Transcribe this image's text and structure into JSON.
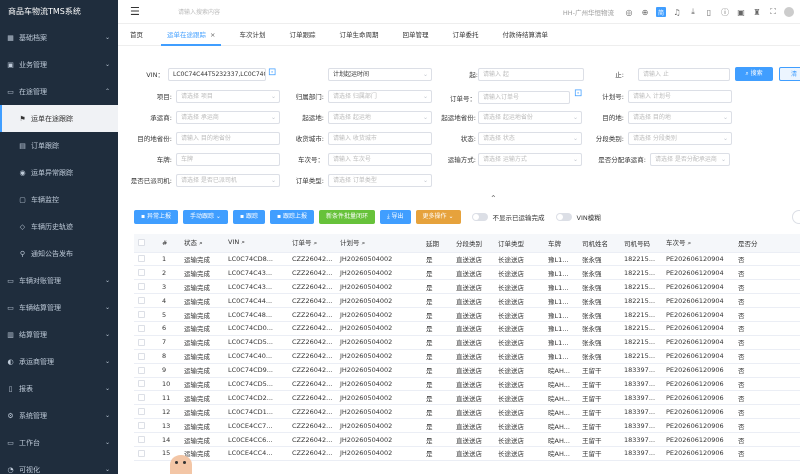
{
  "app": {
    "title": "商品车物流TMS系统"
  },
  "sidebar": {
    "items": [
      {
        "label": "基础档案",
        "icon": "grid-icon"
      },
      {
        "label": "业务管理",
        "icon": "briefcase-icon"
      },
      {
        "label": "在途管理",
        "icon": "truck-icon",
        "open": true
      },
      {
        "label": "车辆对账管理",
        "icon": "truck-icon"
      },
      {
        "label": "车辆结算管理",
        "icon": "truck-icon"
      },
      {
        "label": "结算管理",
        "icon": "calculator-icon"
      },
      {
        "label": "承运商管理",
        "icon": "user-icon"
      },
      {
        "label": "报表",
        "icon": "file-icon"
      },
      {
        "label": "系统管理",
        "icon": "gear-icon"
      },
      {
        "label": "工作台",
        "icon": "desktop-icon"
      },
      {
        "label": "可视化",
        "icon": "chart-icon"
      }
    ],
    "sub_items": [
      {
        "label": "运单在途跟踪",
        "icon": "flag-icon"
      },
      {
        "label": "订单跟踪",
        "icon": "doc-icon"
      },
      {
        "label": "运单异常跟踪",
        "icon": "alert-icon"
      },
      {
        "label": "车辆监控",
        "icon": "monitor-icon"
      },
      {
        "label": "车辆历史轨迹",
        "icon": "route-icon"
      },
      {
        "label": "通知公告发布",
        "icon": "pin-icon"
      }
    ]
  },
  "topbar": {
    "search_placeholder": "请输入搜索内容",
    "org": "HH-广州华恒物流",
    "badge": "简"
  },
  "tabs": [
    {
      "label": "首页"
    },
    {
      "label": "运单在途跟踪",
      "active": true
    },
    {
      "label": "车次计划"
    },
    {
      "label": "订单跟踪"
    },
    {
      "label": "订单生命周期"
    },
    {
      "label": "回单管理"
    },
    {
      "label": "订单委托"
    },
    {
      "label": "付款待结算清单"
    }
  ],
  "filters": {
    "vin": {
      "label": "VIN：",
      "value": "LC0C74C44T5232337,LC0C74C4"
    },
    "time_type": {
      "value": "计划起运时间"
    },
    "from": {
      "label": "起:",
      "placeholder": "请输入 起"
    },
    "to": {
      "label": "止:",
      "placeholder": "请输入 止"
    },
    "project": {
      "label": "项目:",
      "placeholder": "请选择 项目"
    },
    "dept": {
      "label": "归属部门:",
      "placeholder": "请选择 归属部门"
    },
    "order_no": {
      "label": "订单号：",
      "placeholder": "请输入订单号"
    },
    "plan_no": {
      "label": "计划号:",
      "placeholder": "请输入 计划号"
    },
    "carrier": {
      "label": "承运商:",
      "placeholder": "请选择 承运商"
    },
    "start_place": {
      "label": "起运地:",
      "placeholder": "请选择 起运地"
    },
    "start_province": {
      "label": "起运地省份:",
      "placeholder": "请选择 起运地省份"
    },
    "dest": {
      "label": "目的地:",
      "placeholder": "请选择 目的地"
    },
    "dest_province": {
      "label": "目的地省份:",
      "placeholder": "请输入 目的地省份"
    },
    "receiver_city": {
      "label": "收货城市:",
      "placeholder": "请输入 收货城市"
    },
    "status": {
      "label": "状态:",
      "placeholder": "请选择 状态"
    },
    "segment_type": {
      "label": "分段类别:",
      "placeholder": "请选择 分段类别"
    },
    "plate": {
      "label": "车牌:",
      "placeholder": "车牌"
    },
    "trip_no": {
      "label": "车次号：",
      "placeholder": "请输入 车次号"
    },
    "transport_mode": {
      "label": "运输方式:",
      "placeholder": "请选择 运输方式"
    },
    "assigned_carrier": {
      "label": "是否分配承运商:",
      "placeholder": "请选择 是否分配承运商"
    },
    "driver_assigned": {
      "label": "是否已派司机:",
      "placeholder": "请选择 是否已派司机"
    },
    "order_type": {
      "label": "订单类型:",
      "placeholder": "请选择 订单类型"
    },
    "search_btn": "搜索",
    "reset_btn": "清"
  },
  "toolbar": {
    "buttons": [
      {
        "label": "异常上报",
        "color": "blue"
      },
      {
        "label": "手动跟踪",
        "color": "blue"
      },
      {
        "label": "跟踪",
        "color": "blue"
      },
      {
        "label": "跟踪上报",
        "color": "blue"
      },
      {
        "label": "新条件批量闭环",
        "color": "green"
      },
      {
        "label": "导出",
        "color": "blue"
      },
      {
        "label": "更多操作",
        "color": "orange"
      }
    ],
    "switch1": "不显示已运输完成",
    "switch2": "VIN模糊"
  },
  "table": {
    "headers": [
      "",
      "#",
      "状态",
      "VIN",
      "订单号",
      "计划号",
      "延期",
      "分段类别",
      "订单类型",
      "车牌",
      "司机姓名",
      "司机号码",
      "车次号",
      "是否分"
    ],
    "rows": [
      [
        "1",
        "运输完成",
        "LC0C74CD8...",
        "CZZ26042...",
        "JH20260504002",
        "是",
        "直送送店",
        "长途送店",
        "豫L1...",
        "张永强",
        "182215...",
        "PE202606120904",
        "否"
      ],
      [
        "2",
        "运输完成",
        "LC0C74C43...",
        "CZZ26042...",
        "JH20260504002",
        "是",
        "直送送店",
        "长途送店",
        "豫L1...",
        "张永强",
        "182215...",
        "PE202606120904",
        "否"
      ],
      [
        "3",
        "运输完成",
        "LC0C74C43...",
        "CZZ26042...",
        "JH20260504002",
        "是",
        "直送送店",
        "长途送店",
        "豫L1...",
        "张永强",
        "182215...",
        "PE202606120904",
        "否"
      ],
      [
        "4",
        "运输完成",
        "LC0C74C44...",
        "CZZ26042...",
        "JH20260504002",
        "是",
        "直送送店",
        "长途送店",
        "豫L1...",
        "张永强",
        "182215...",
        "PE202606120904",
        "否"
      ],
      [
        "5",
        "运输完成",
        "LC0C74C48...",
        "CZZ26042...",
        "JH20260504002",
        "是",
        "直送送店",
        "长途送店",
        "豫L1...",
        "张永强",
        "182215...",
        "PE202606120904",
        "否"
      ],
      [
        "6",
        "运输完成",
        "LC0C74CD0...",
        "CZZ26042...",
        "JH20260504002",
        "是",
        "直送送店",
        "长途送店",
        "豫L1...",
        "张永强",
        "182215...",
        "PE202606120904",
        "否"
      ],
      [
        "7",
        "运输完成",
        "LC0C74CD5...",
        "CZZ26042...",
        "JH20260504002",
        "是",
        "直送送店",
        "长途送店",
        "豫L1...",
        "张永强",
        "182215...",
        "PE202606120904",
        "否"
      ],
      [
        "8",
        "运输完成",
        "LC0C74C40...",
        "CZZ26042...",
        "JH20260504002",
        "是",
        "直送送店",
        "长途送店",
        "豫L1...",
        "张永强",
        "182215...",
        "PE202606120904",
        "否"
      ],
      [
        "9",
        "运输完成",
        "LC0C74CD9...",
        "CZZ26042...",
        "JH20260504002",
        "是",
        "直送送店",
        "长途送店",
        "晥AH...",
        "王留干",
        "183397...",
        "PE202606120906",
        "否"
      ],
      [
        "10",
        "运输完成",
        "LC0C74CD5...",
        "CZZ26042...",
        "JH20260504002",
        "是",
        "直送送店",
        "长途送店",
        "晥AH...",
        "王留干",
        "183397...",
        "PE202606120906",
        "否"
      ],
      [
        "11",
        "运输完成",
        "LC0C74CD2...",
        "CZZ26042...",
        "JH20260504002",
        "是",
        "直送送店",
        "长途送店",
        "晥AH...",
        "王留干",
        "183397...",
        "PE202606120906",
        "否"
      ],
      [
        "12",
        "运输完成",
        "LC0C74CD1...",
        "CZZ26042...",
        "JH20260504002",
        "是",
        "直送送店",
        "长途送店",
        "晥AH...",
        "王留干",
        "183397...",
        "PE202606120906",
        "否"
      ],
      [
        "13",
        "运输完成",
        "LC0CE4CC7...",
        "CZZ26042...",
        "JH20260504002",
        "是",
        "直送送店",
        "长途送店",
        "晥AH...",
        "王留干",
        "183397...",
        "PE202606120906",
        "否"
      ],
      [
        "14",
        "运输完成",
        "LC0CE4CC6...",
        "CZZ26042...",
        "JH20260504002",
        "是",
        "直送送店",
        "长途送店",
        "晥AH...",
        "王留干",
        "183397...",
        "PE202606120906",
        "否"
      ],
      [
        "15",
        "运输完成",
        "LC0CE4CC4...",
        "CZZ26042...",
        "JH20260504002",
        "是",
        "直送送店",
        "长途送店",
        "晥AH...",
        "王留干",
        "183397...",
        "PE202606120906",
        "否"
      ]
    ]
  }
}
